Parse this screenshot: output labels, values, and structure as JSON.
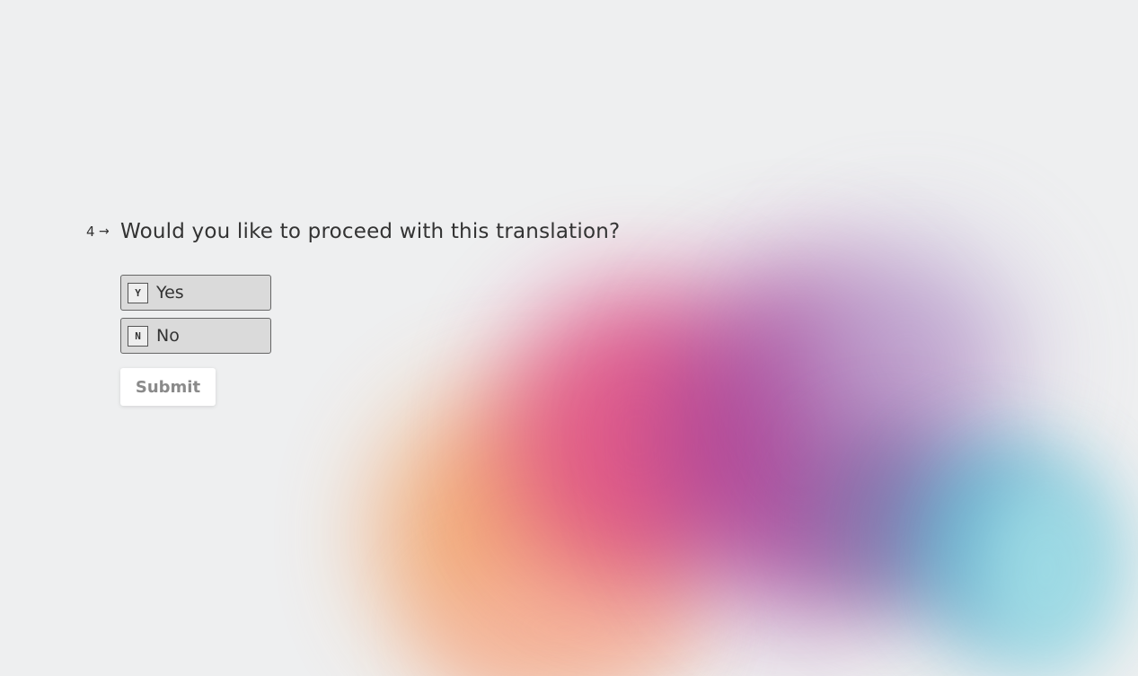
{
  "question": {
    "number": "4",
    "arrow_icon": "→",
    "text": "Would you like to proceed with this translation?"
  },
  "choices": [
    {
      "key": "Y",
      "label": "Yes"
    },
    {
      "key": "N",
      "label": "No"
    }
  ],
  "submit_label": "Submit",
  "colors": {
    "background": "#eeeff0",
    "choice_bg": "#dadada",
    "submit_text": "#8a8a8a"
  }
}
